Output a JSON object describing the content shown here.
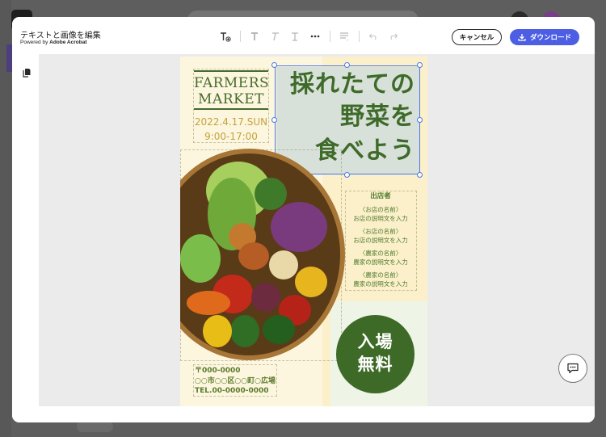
{
  "dialog": {
    "title": "テキストと画像を編集",
    "powered_prefix": "Powered by ",
    "powered_brand": "Adobe Acrobat",
    "cancel_label": "キャンセル",
    "download_label": "ダウンロード"
  },
  "toolbar": {
    "icons": [
      "add-text-icon",
      "bold-icon",
      "italic-icon",
      "text-style-icon",
      "more-icon",
      "align-icon",
      "undo-icon",
      "redo-icon"
    ]
  },
  "poster": {
    "title_line1": "FARMERS",
    "title_line2": "MARKET",
    "date_line": "2022.4.17.SUN",
    "time_line": "9:00-17:00",
    "headline": [
      "採れたての",
      "野菜を",
      "食べよう"
    ],
    "exhibitors_title": "出店者",
    "exhibitors": [
      {
        "name": "〈お店の名前〉",
        "desc": "お店の説明文を入力"
      },
      {
        "name": "〈お店の名前〉",
        "desc": "お店の説明文を入力"
      },
      {
        "name": "〈農家の名前〉",
        "desc": "農家の説明文を入力"
      },
      {
        "name": "〈農家の名前〉",
        "desc": "農家の説明文を入力"
      }
    ],
    "free_entry_line1": "入場",
    "free_entry_line2": "無料",
    "address_lines": [
      "〒000-0000",
      "○○市○○区○○町○広場",
      "TEL.00-0000-0000"
    ]
  },
  "colors": {
    "accent": "#4b5ee4",
    "poster_green": "#3d6a27",
    "poster_gold": "#c2a23d",
    "selection": "#4a77e6"
  }
}
